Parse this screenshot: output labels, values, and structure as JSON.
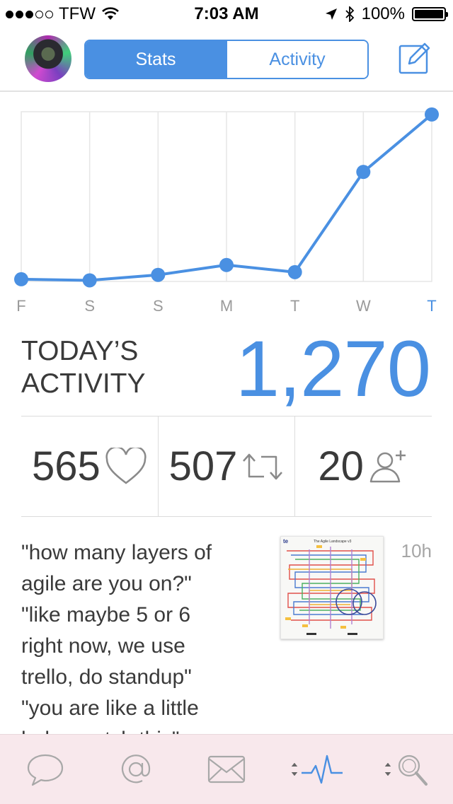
{
  "status_bar": {
    "carrier": "TFW",
    "time": "7:03 AM",
    "battery": "100%",
    "signal_bars_filled": 3,
    "signal_bars_total": 5
  },
  "nav": {
    "tabs": [
      {
        "label": "Stats",
        "active": true
      },
      {
        "label": "Activity",
        "active": false
      }
    ],
    "compose_icon": "compose-icon"
  },
  "chart_data": {
    "type": "line",
    "categories": [
      "F",
      "S",
      "S",
      "M",
      "T",
      "W",
      "T"
    ],
    "values": [
      4,
      2,
      12,
      30,
      17,
      200,
      305
    ],
    "ylim": [
      0,
      310
    ],
    "grid": true,
    "color": "#4a90e2",
    "highlight_last_label": true
  },
  "today": {
    "label": "TODAY’S ACTIVITY",
    "value": "1,270"
  },
  "stats": {
    "likes": "565",
    "retweets": "507",
    "followers": "20"
  },
  "tweet": {
    "text": "\"how many layers of\nagile are you on?\"\n\"like maybe 5 or 6\nright now, we use\ntrello, do standup\"\n\"you are like a little\nbaby, watch this\"",
    "time": "10h",
    "thumbnail_caption": "The Agile Landscape v3",
    "thumbnail_logo": "te"
  },
  "tabbar": {
    "items": [
      "speech-bubble-icon",
      "mention-icon",
      "envelope-icon",
      "activity-icon",
      "search-icon"
    ]
  },
  "colors": {
    "accent": "#4a90e2",
    "text": "#3a3a3a",
    "muted": "#a6a6a6",
    "tabbar_bg": "#f8e8ec"
  }
}
